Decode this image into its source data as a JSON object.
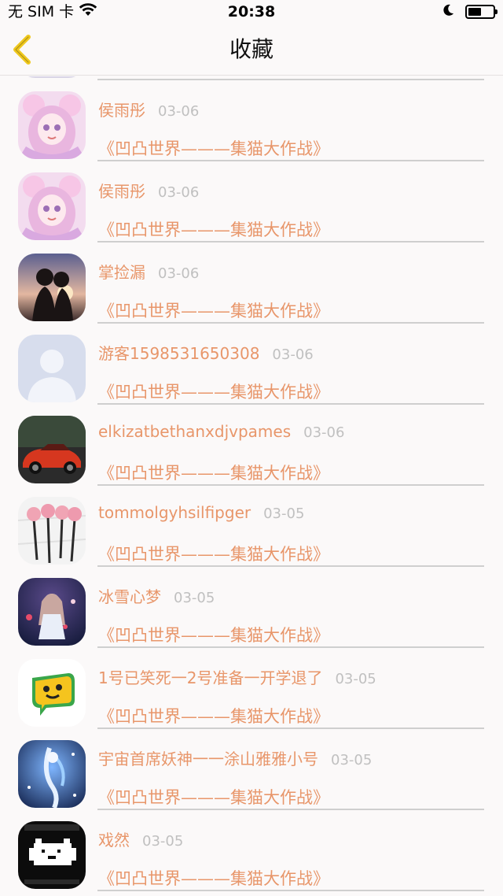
{
  "status": {
    "carrier": "无 SIM 卡",
    "time": "20:38"
  },
  "nav": {
    "title": "收藏",
    "back_icon": "chevron-left-icon",
    "accent": "#efc81d"
  },
  "colors": {
    "name": "#e8966a",
    "date": "#c0c0c0",
    "divider": "#cfcfcf"
  },
  "items": [
    {
      "name": "侯雨彤",
      "date": "03-06",
      "title": "《凹凸世界———集猫大作战》",
      "avatar": "anime-girl-avatar"
    },
    {
      "name": "侯雨彤",
      "date": "03-06",
      "title": "《凹凸世界———集猫大作战》",
      "avatar": "anime-girl-avatar"
    },
    {
      "name": "掌捡漏",
      "date": "03-06",
      "title": "《凹凸世界———集猫大作战》",
      "avatar": "sunset-couple-avatar"
    },
    {
      "name": "游客1598531650308",
      "date": "03-06",
      "title": "《凹凸世界———集猫大作战》",
      "avatar": "default-user-avatar"
    },
    {
      "name": "elkizatbethanxdjvpames",
      "date": "03-06",
      "title": "《凹凸世界———集猫大作战》",
      "avatar": "red-car-avatar"
    },
    {
      "name": "tommolgyhsilfipger",
      "date": "03-05",
      "title": "《凹凸世界———集猫大作战》",
      "avatar": "roses-avatar"
    },
    {
      "name": "冰雪心梦",
      "date": "03-05",
      "title": "《凹凸世界———集猫大作战》",
      "avatar": "night-girl-avatar"
    },
    {
      "name": "1号已笑死一2号准备一开学退了",
      "date": "03-05",
      "title": "《凹凸世界———集猫大作战》",
      "avatar": "smiley-bubble-avatar"
    },
    {
      "name": "宇宙首席妖神一一涂山雅雅小号",
      "date": "03-05",
      "title": "《凹凸世界———集猫大作战》",
      "avatar": "blue-fantasy-avatar"
    },
    {
      "name": "戏然",
      "date": "03-05",
      "title": "《凹凸世界———集猫大作战》",
      "avatar": "pixel-dog-avatar"
    }
  ]
}
